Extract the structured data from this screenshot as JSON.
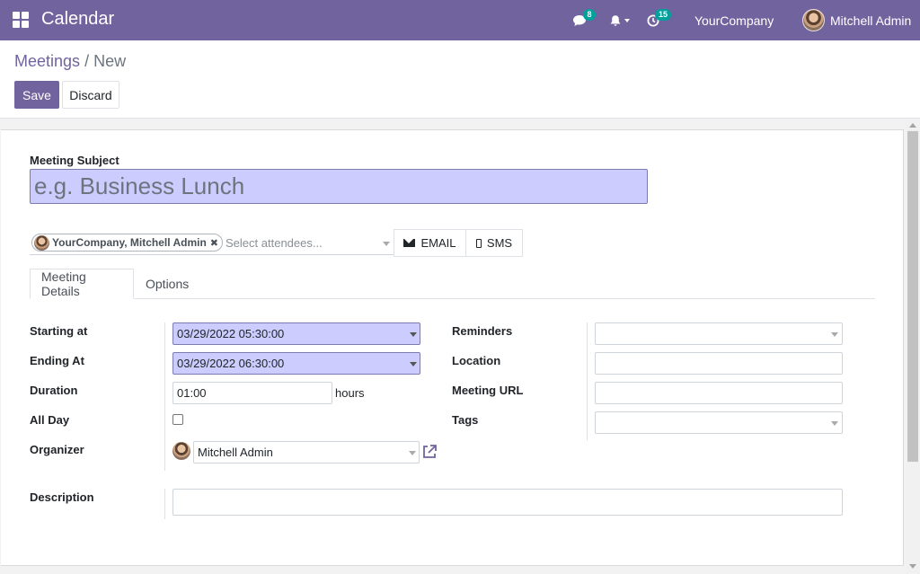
{
  "navbar": {
    "app_title": "Calendar",
    "chat_badge": "8",
    "activity_badge": "15",
    "company": "YourCompany",
    "user": "Mitchell Admin"
  },
  "breadcrumb": {
    "parent": "Meetings",
    "separator": "/",
    "current": "New"
  },
  "buttons": {
    "save": "Save",
    "discard": "Discard",
    "email": "EMAIL",
    "sms": "SMS"
  },
  "form": {
    "subject_label": "Meeting Subject",
    "subject_placeholder": "e.g. Business Lunch",
    "attendee_tag": "YourCompany, Mitchell Admin",
    "attendee_placeholder": "Select attendees...",
    "tabs": [
      {
        "label": "Meeting Details",
        "active": true
      },
      {
        "label": "Options",
        "active": false
      }
    ],
    "left_fields": {
      "starting_at": {
        "label": "Starting at",
        "value": "03/29/2022 05:30:00"
      },
      "ending_at": {
        "label": "Ending At",
        "value": "03/29/2022 06:30:00"
      },
      "duration": {
        "label": "Duration",
        "value": "01:00",
        "unit": "hours"
      },
      "all_day": {
        "label": "All Day",
        "checked": false
      },
      "organizer": {
        "label": "Organizer",
        "value": "Mitchell Admin"
      }
    },
    "right_fields": {
      "reminders": {
        "label": "Reminders",
        "value": ""
      },
      "location": {
        "label": "Location",
        "value": ""
      },
      "meeting_url": {
        "label": "Meeting URL",
        "value": ""
      },
      "tags": {
        "label": "Tags",
        "value": ""
      }
    },
    "description": {
      "label": "Description",
      "value": ""
    }
  },
  "colors": {
    "brand": "#71639e",
    "highlight_field": "#ccccff",
    "badge": "#00a09d"
  },
  "icons": [
    "apps-grid-icon",
    "chat-icon",
    "bell-icon",
    "activity-clock-icon",
    "user-avatar",
    "envelope-icon",
    "phone-icon",
    "external-link-icon"
  ]
}
